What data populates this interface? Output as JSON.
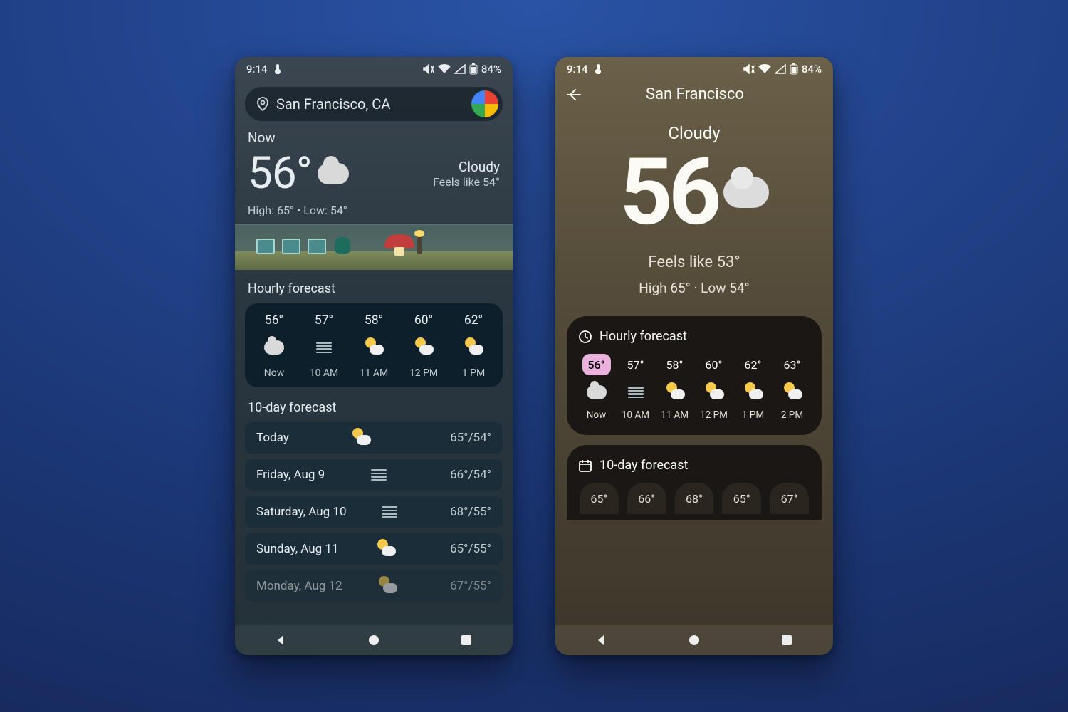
{
  "status": {
    "time": "9:14",
    "battery": "84%"
  },
  "phone1": {
    "location": "San Francisco, CA",
    "now_label": "Now",
    "temp": "56°",
    "condition": "Cloudy",
    "feels": "Feels like 54°",
    "hilo": "High: 65° • Low: 54°",
    "hourly_title": "Hourly forecast",
    "hourly": [
      {
        "temp": "56°",
        "icon": "cloud",
        "label": "Now"
      },
      {
        "temp": "57°",
        "icon": "fog",
        "label": "10 AM"
      },
      {
        "temp": "58°",
        "icon": "partly",
        "label": "11 AM"
      },
      {
        "temp": "60°",
        "icon": "partly",
        "label": "12 PM"
      },
      {
        "temp": "62°",
        "icon": "partly",
        "label": "1 PM"
      }
    ],
    "ten_title": "10-day forecast",
    "daily": [
      {
        "day": "Today",
        "icon": "partly",
        "hi": "65°",
        "lo": "54°"
      },
      {
        "day": "Friday, Aug 9",
        "icon": "fog",
        "hi": "66°",
        "lo": "54°"
      },
      {
        "day": "Saturday, Aug 10",
        "icon": "fog",
        "hi": "68°",
        "lo": "55°"
      },
      {
        "day": "Sunday, Aug 11",
        "icon": "partly",
        "hi": "65°",
        "lo": "55°"
      },
      {
        "day": "Monday, Aug 12",
        "icon": "partly",
        "hi": "67°",
        "lo": "55°"
      }
    ]
  },
  "phone2": {
    "title": "San Francisco",
    "condition": "Cloudy",
    "temp": "56",
    "feels": "Feels like 53°",
    "hilo": "High 65° · Low 54°",
    "hourly_title": "Hourly forecast",
    "hourly": [
      {
        "temp": "56°",
        "icon": "cloud",
        "label": "Now",
        "now": true
      },
      {
        "temp": "57°",
        "icon": "fog",
        "label": "10 AM"
      },
      {
        "temp": "58°",
        "icon": "partly",
        "label": "11 AM"
      },
      {
        "temp": "60°",
        "icon": "partly",
        "label": "12 PM"
      },
      {
        "temp": "62°",
        "icon": "partly",
        "label": "1 PM"
      },
      {
        "temp": "63°",
        "icon": "partly",
        "label": "2 PM"
      }
    ],
    "ten_title": "10-day forecast",
    "highs": [
      "65°",
      "66°",
      "68°",
      "65°",
      "67°"
    ]
  }
}
